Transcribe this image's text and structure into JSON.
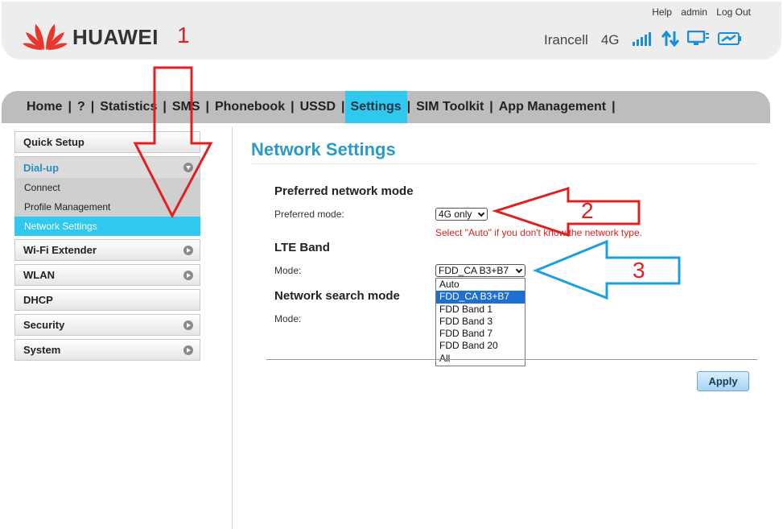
{
  "header": {
    "brand": "HUAWEI",
    "top_links": [
      "Help",
      "admin",
      "Log Out"
    ],
    "operator": "Irancell",
    "network_type": "4G"
  },
  "menu": {
    "items": [
      "Home",
      "?",
      "Statistics",
      "SMS",
      "Phonebook",
      "USSD",
      "Settings",
      "SIM Toolkit",
      "App Management"
    ],
    "active": "Settings"
  },
  "sidebar": {
    "quick_setup": "Quick Setup",
    "dialup": "Dial-up",
    "dialup_items": [
      "Connect",
      "Profile Management",
      "Network Settings"
    ],
    "wifi_extender": "Wi-Fi Extender",
    "wlan": "WLAN",
    "dhcp": "DHCP",
    "security": "Security",
    "system": "System"
  },
  "main": {
    "title": "Network Settings",
    "preferred": {
      "heading": "Preferred network mode",
      "label": "Preferred mode:",
      "value": "4G only",
      "hint": "Select \"Auto\" if you don't know the network type."
    },
    "lte": {
      "heading": "LTE Band",
      "label": "Mode:",
      "value": "FDD_CA B3+B7",
      "options": [
        "Auto",
        "FDD_CA B3+B7",
        "FDD Band 1",
        "FDD Band 3",
        "FDD Band 7",
        "FDD Band 20",
        "All"
      ]
    },
    "search": {
      "heading": "Network search mode",
      "label": "Mode:"
    },
    "apply_label": "Apply"
  },
  "annotations": {
    "numbers": [
      "1",
      "2",
      "3"
    ],
    "colors": {
      "red": "#e02020",
      "blue": "#1a9fe0"
    }
  }
}
